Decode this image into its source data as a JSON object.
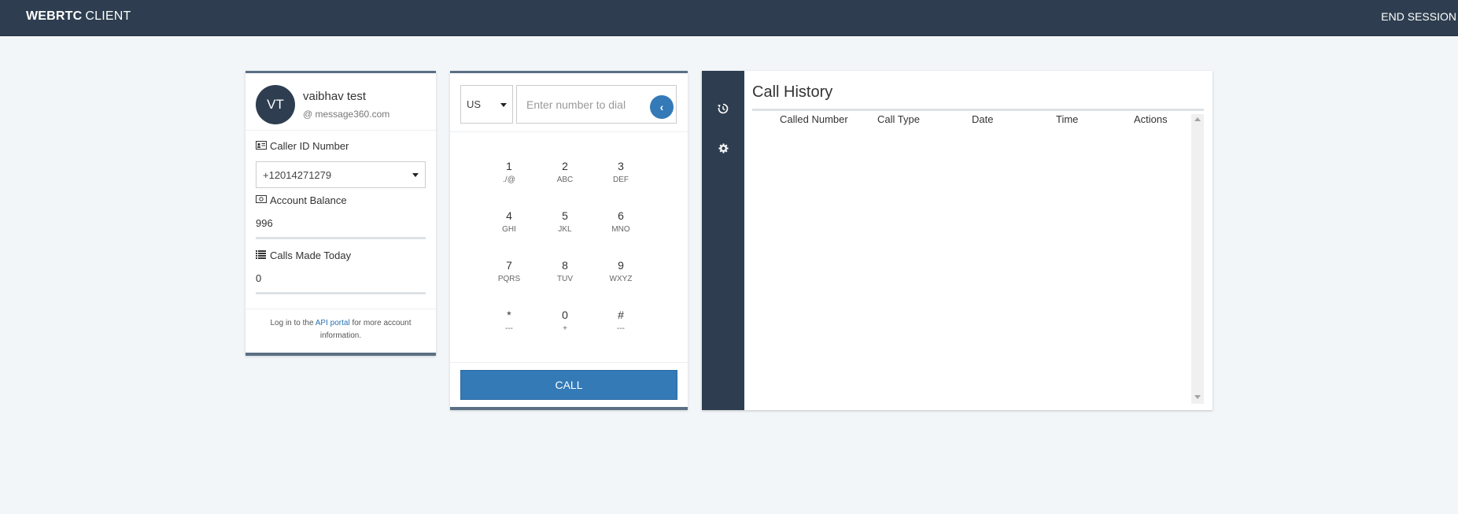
{
  "header": {
    "brand_strong": "WEBRTC",
    "brand_light": "CLIENT",
    "end_session": "END SESSION"
  },
  "account": {
    "initials": "VT",
    "name": "vaibhav test",
    "domain": "@ message360.com",
    "caller_id_label": "Caller ID Number",
    "caller_id_value": "+12014271279",
    "balance_label": "Account Balance",
    "balance_value": "996",
    "calls_label": "Calls Made Today",
    "calls_value": "0",
    "footer_prefix": "Log in to the ",
    "footer_link": "API portal",
    "footer_suffix": " for more account information."
  },
  "dialer": {
    "country": "US",
    "number_placeholder": "Enter number to dial",
    "back_icon": "‹",
    "keys": [
      {
        "digit": "1",
        "letters": "./@"
      },
      {
        "digit": "2",
        "letters": "ABC"
      },
      {
        "digit": "3",
        "letters": "DEF"
      },
      {
        "digit": "4",
        "letters": "GHI"
      },
      {
        "digit": "5",
        "letters": "JKL"
      },
      {
        "digit": "6",
        "letters": "MNO"
      },
      {
        "digit": "7",
        "letters": "PQRS"
      },
      {
        "digit": "8",
        "letters": "TUV"
      },
      {
        "digit": "9",
        "letters": "WXYZ"
      },
      {
        "digit": "*",
        "letters": "---"
      },
      {
        "digit": "0",
        "letters": "+"
      },
      {
        "digit": "#",
        "letters": "---"
      }
    ],
    "call_label": "CALL"
  },
  "history": {
    "title": "Call History",
    "columns": [
      "Called Number",
      "Call Type",
      "Date",
      "Time",
      "Actions"
    ],
    "side_icons": [
      "history-icon",
      "gear-icon"
    ]
  },
  "colors": {
    "navbar": "#2e3e50",
    "accent": "#337ab7",
    "background": "#f2f6f9"
  }
}
